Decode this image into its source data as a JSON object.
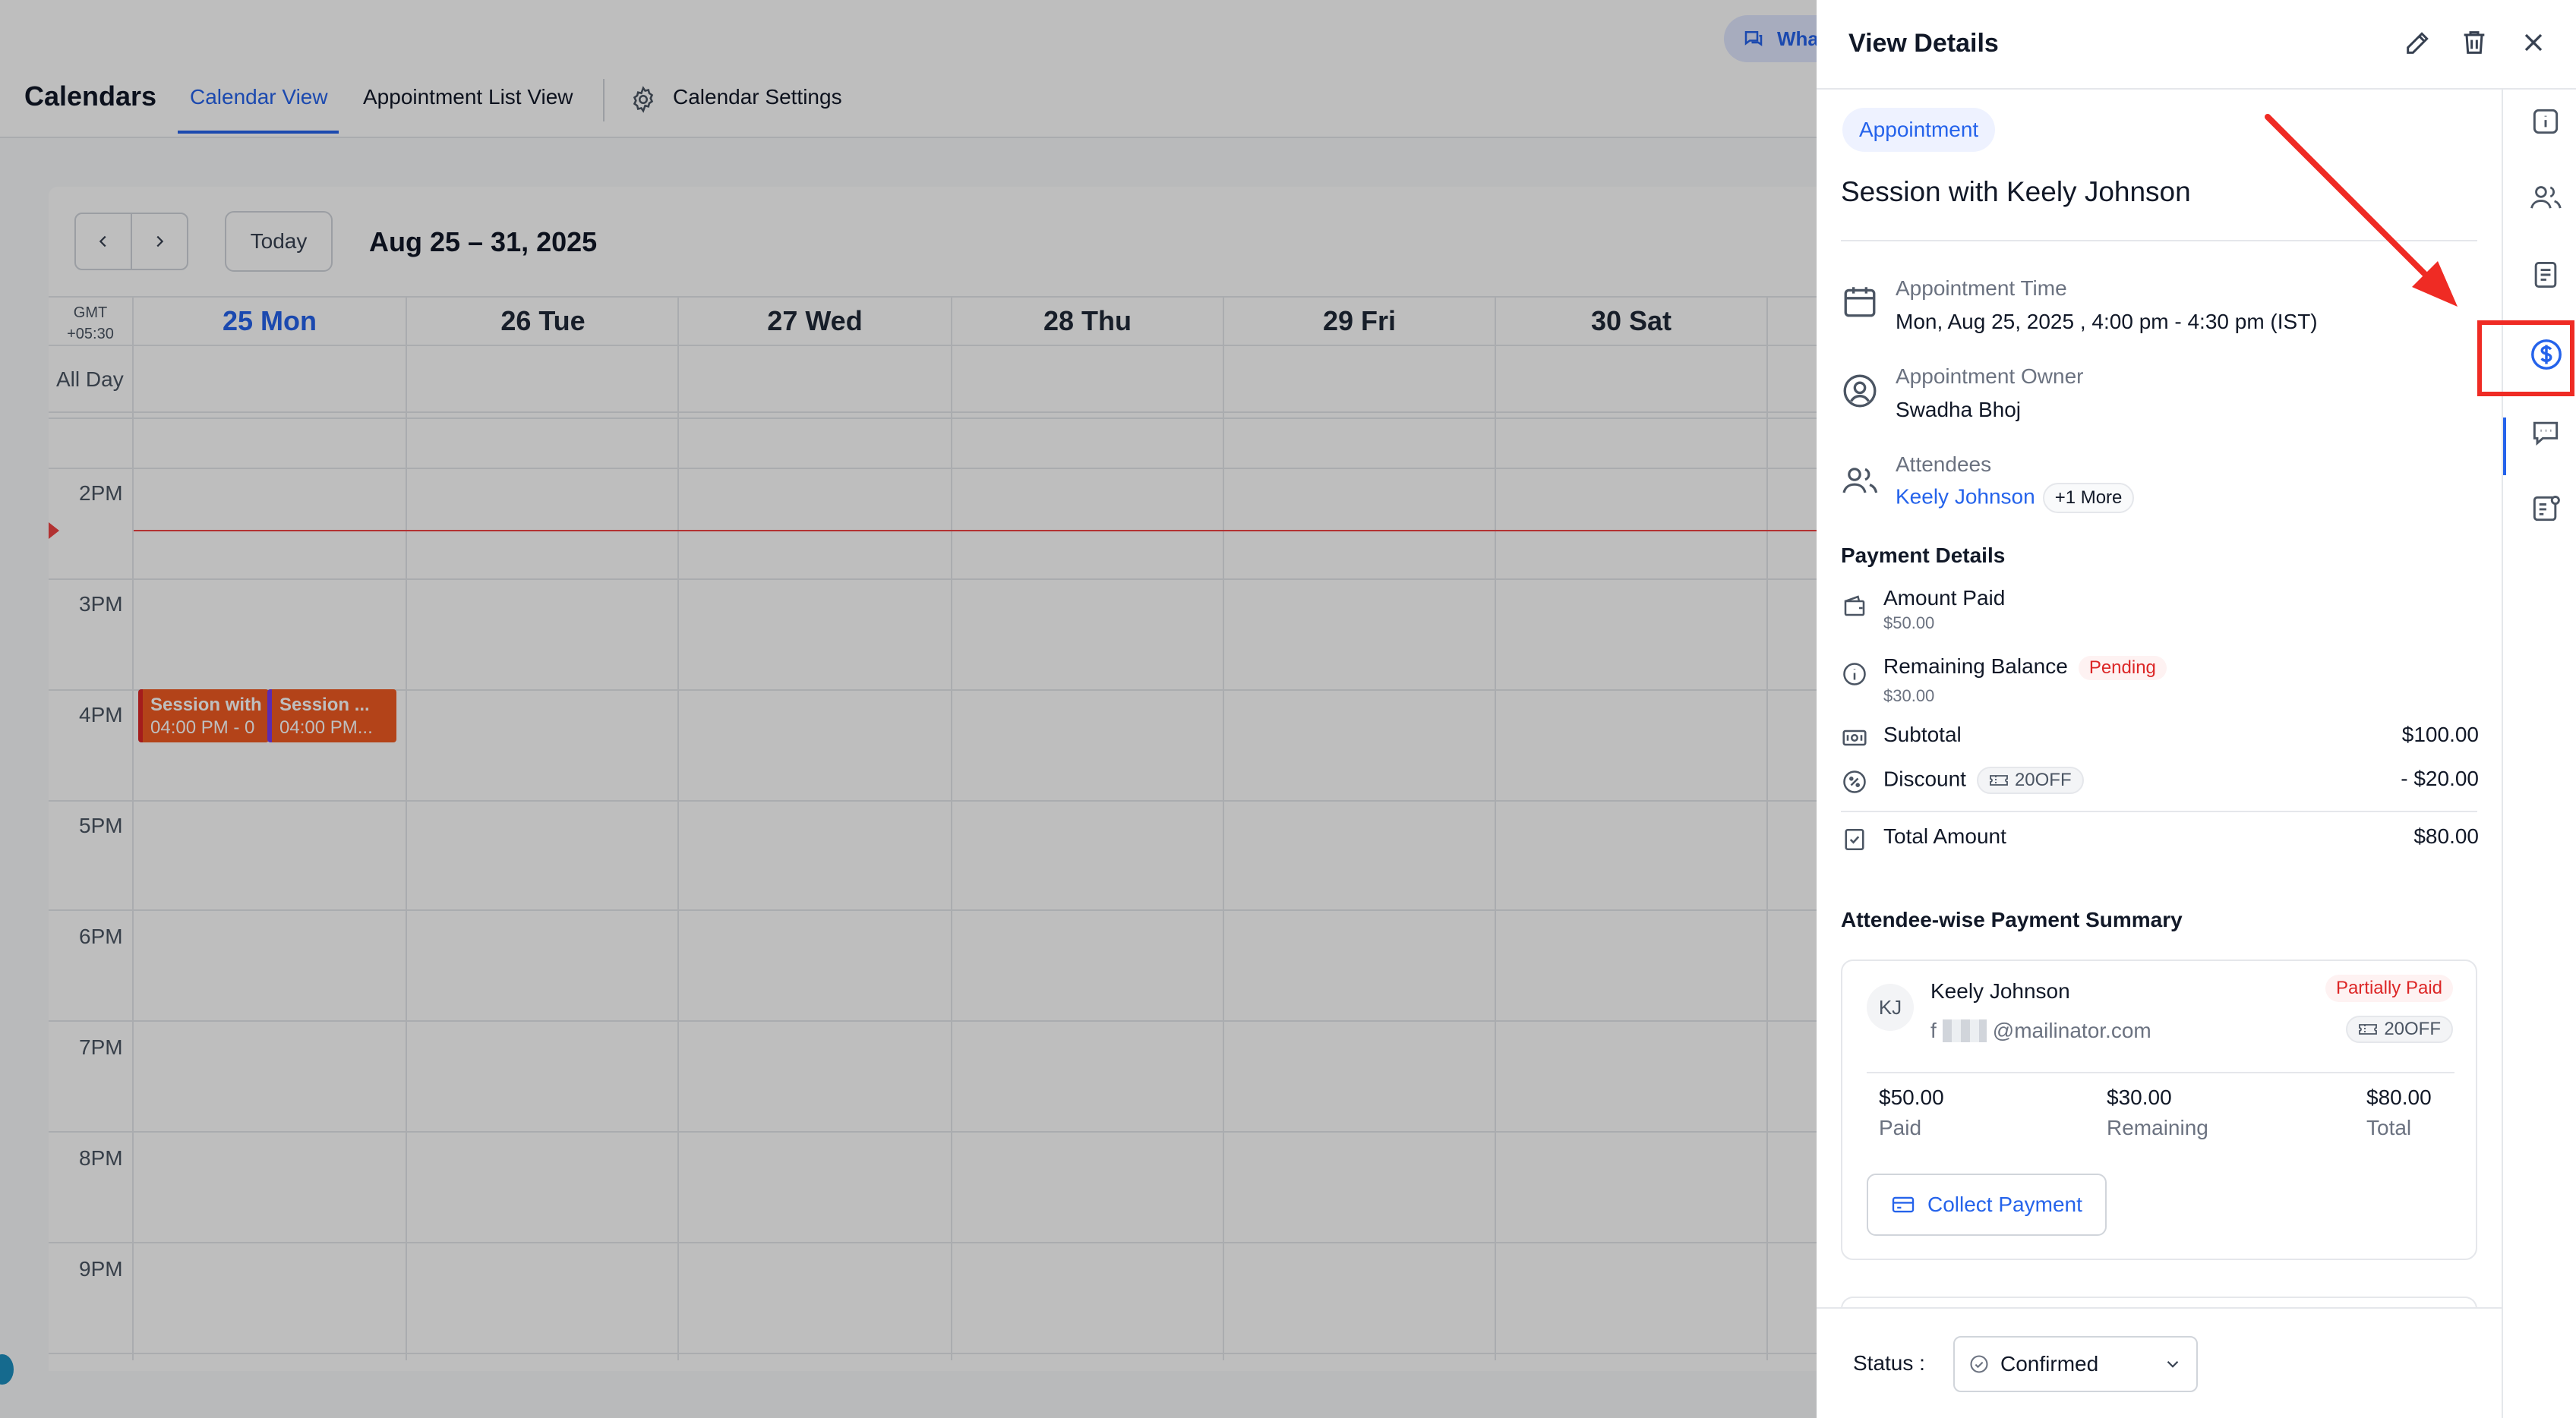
{
  "header": {
    "app_title": "Calendars",
    "top_chip_label": "Wha",
    "tabs": [
      {
        "label": "Calendar View",
        "active": true
      },
      {
        "label": "Appointment List View",
        "active": false
      },
      {
        "label": "Calendar Settings",
        "active": false
      }
    ]
  },
  "toolbar": {
    "today_label": "Today",
    "range_label": "Aug 25 – 31, 2025"
  },
  "calendar": {
    "timezone_line1": "GMT",
    "timezone_line2": "+05:30",
    "all_day_label": "All Day",
    "days": [
      "25 Mon",
      "26 Tue",
      "27 Wed",
      "28 Thu",
      "29 Fri",
      "30 Sat"
    ],
    "hours": [
      "2PM",
      "3PM",
      "4PM",
      "5PM",
      "6PM",
      "7PM",
      "8PM",
      "9PM"
    ],
    "events": [
      {
        "title": "Session with",
        "time": "04:00 PM - 0"
      },
      {
        "title": "Session ...",
        "time": "04:00 PM..."
      }
    ]
  },
  "drawer": {
    "title": "View Details",
    "type_badge": "Appointment",
    "session_title": "Session with Keely Johnson",
    "appointment_time_label": "Appointment Time",
    "appointment_time_value": "Mon, Aug 25, 2025 , 4:00 pm - 4:30 pm (IST)",
    "owner_label": "Appointment Owner",
    "owner_value": "Swadha Bhoj",
    "attendees_label": "Attendees",
    "attendee_primary": "Keely Johnson",
    "attendees_more": "+1 More",
    "payment": {
      "section_title": "Payment Details",
      "amount_paid_label": "Amount Paid",
      "amount_paid_value": "$50.00",
      "remaining_label": "Remaining Balance",
      "remaining_status": "Pending",
      "remaining_value": "$30.00",
      "subtotal_label": "Subtotal",
      "subtotal_value": "$100.00",
      "discount_label": "Discount",
      "discount_code": "20OFF",
      "discount_value": "- $20.00",
      "total_label": "Total Amount",
      "total_value": "$80.00"
    },
    "attendee_summary": {
      "section_title": "Attendee-wise Payment Summary",
      "initials": "KJ",
      "name": "Keely Johnson",
      "email_prefix": "f",
      "email_domain": "@mailinator.com",
      "status": "Partially Paid",
      "coupon": "20OFF",
      "paid_value": "$50.00",
      "paid_label": "Paid",
      "remaining_value": "$30.00",
      "remaining_label": "Remaining",
      "total_value": "$80.00",
      "total_label": "Total",
      "collect_button": "Collect Payment"
    },
    "status_label": "Status :",
    "status_value": "Confirmed"
  },
  "colors": {
    "accent": "#2563eb",
    "event": "#f05a22",
    "now_line": "#ef4444",
    "annotation": "#ef2b24"
  }
}
